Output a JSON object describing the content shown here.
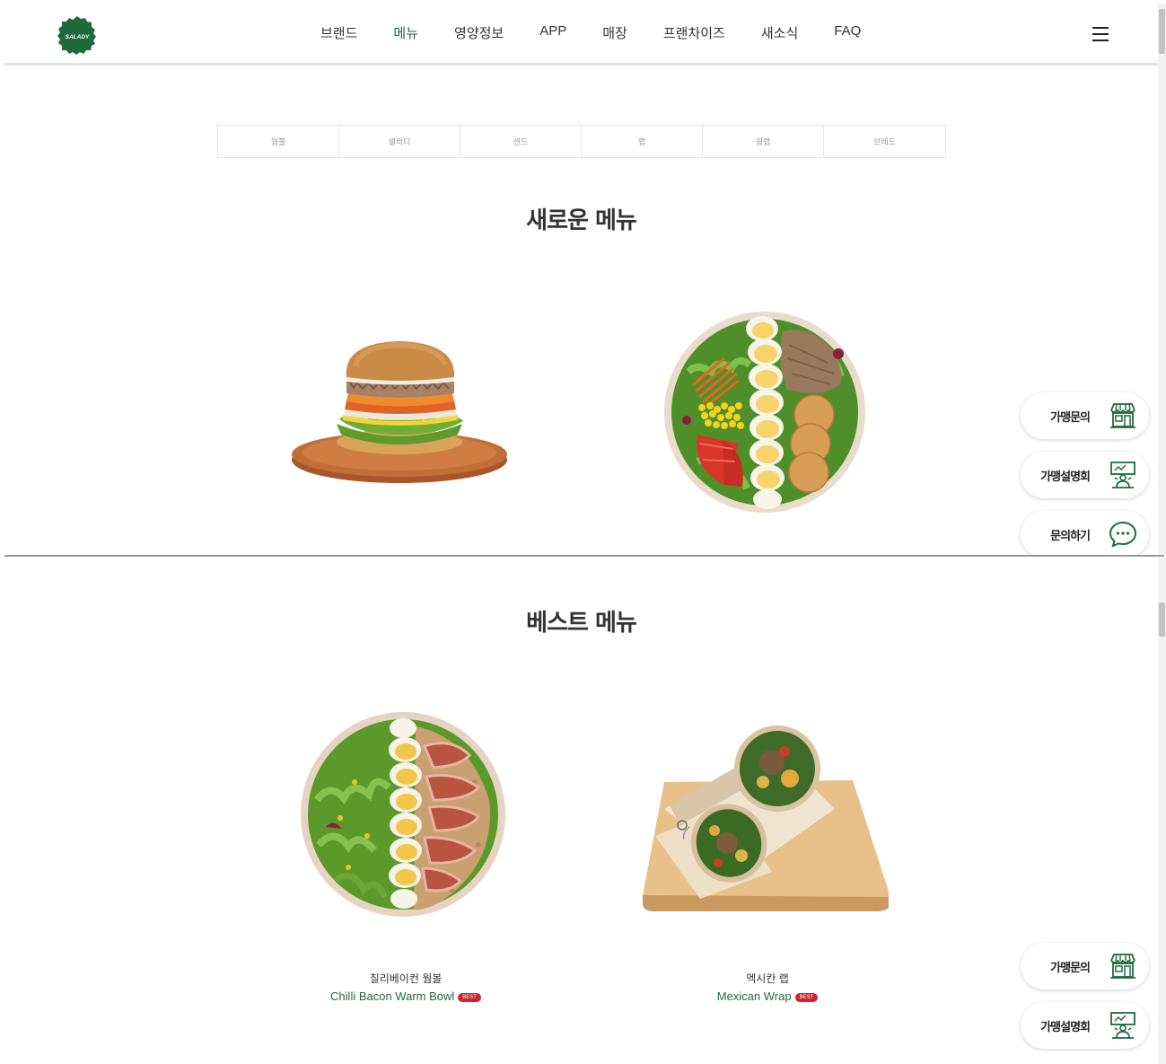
{
  "header": {
    "logo_text": "SALADY",
    "nav": [
      {
        "label": "브랜드"
      },
      {
        "label": "메뉴"
      },
      {
        "label": "영양정보"
      },
      {
        "label": "APP"
      },
      {
        "label": "매장"
      },
      {
        "label": "프랜차이즈"
      },
      {
        "label": "새소식"
      },
      {
        "label": "FAQ"
      }
    ],
    "active_nav": "메뉴"
  },
  "tabs": [
    {
      "label": "웜볼"
    },
    {
      "label": "샐러디"
    },
    {
      "label": "샌드"
    },
    {
      "label": "랩"
    },
    {
      "label": "웜랩"
    },
    {
      "label": "브레드"
    }
  ],
  "new_menu": {
    "title": "새로운 메뉴",
    "items": [
      {
        "image": "burger"
      },
      {
        "image": "salad-bowl"
      }
    ]
  },
  "best_menu": {
    "title": "베스트 메뉴",
    "items": [
      {
        "name_kr": "칠리베이컨 웜볼",
        "name_en": "Chilli Bacon Warm Bowl",
        "badge": "BEST"
      },
      {
        "name_kr": "멕시칸 랩",
        "name_en": "Mexican Wrap",
        "badge": "BEST"
      }
    ]
  },
  "floating": {
    "franchise_inquiry": "가맹문의",
    "franchise_briefing": "가맹설명회",
    "contact": "문의하기"
  },
  "colors": {
    "brand_green": "#1e6a3c",
    "badge_red": "#d3232f"
  },
  "icons": {
    "store": "store-icon",
    "presenter": "presenter-icon",
    "chat": "chat-bubble-icon",
    "menu": "hamburger-icon"
  }
}
